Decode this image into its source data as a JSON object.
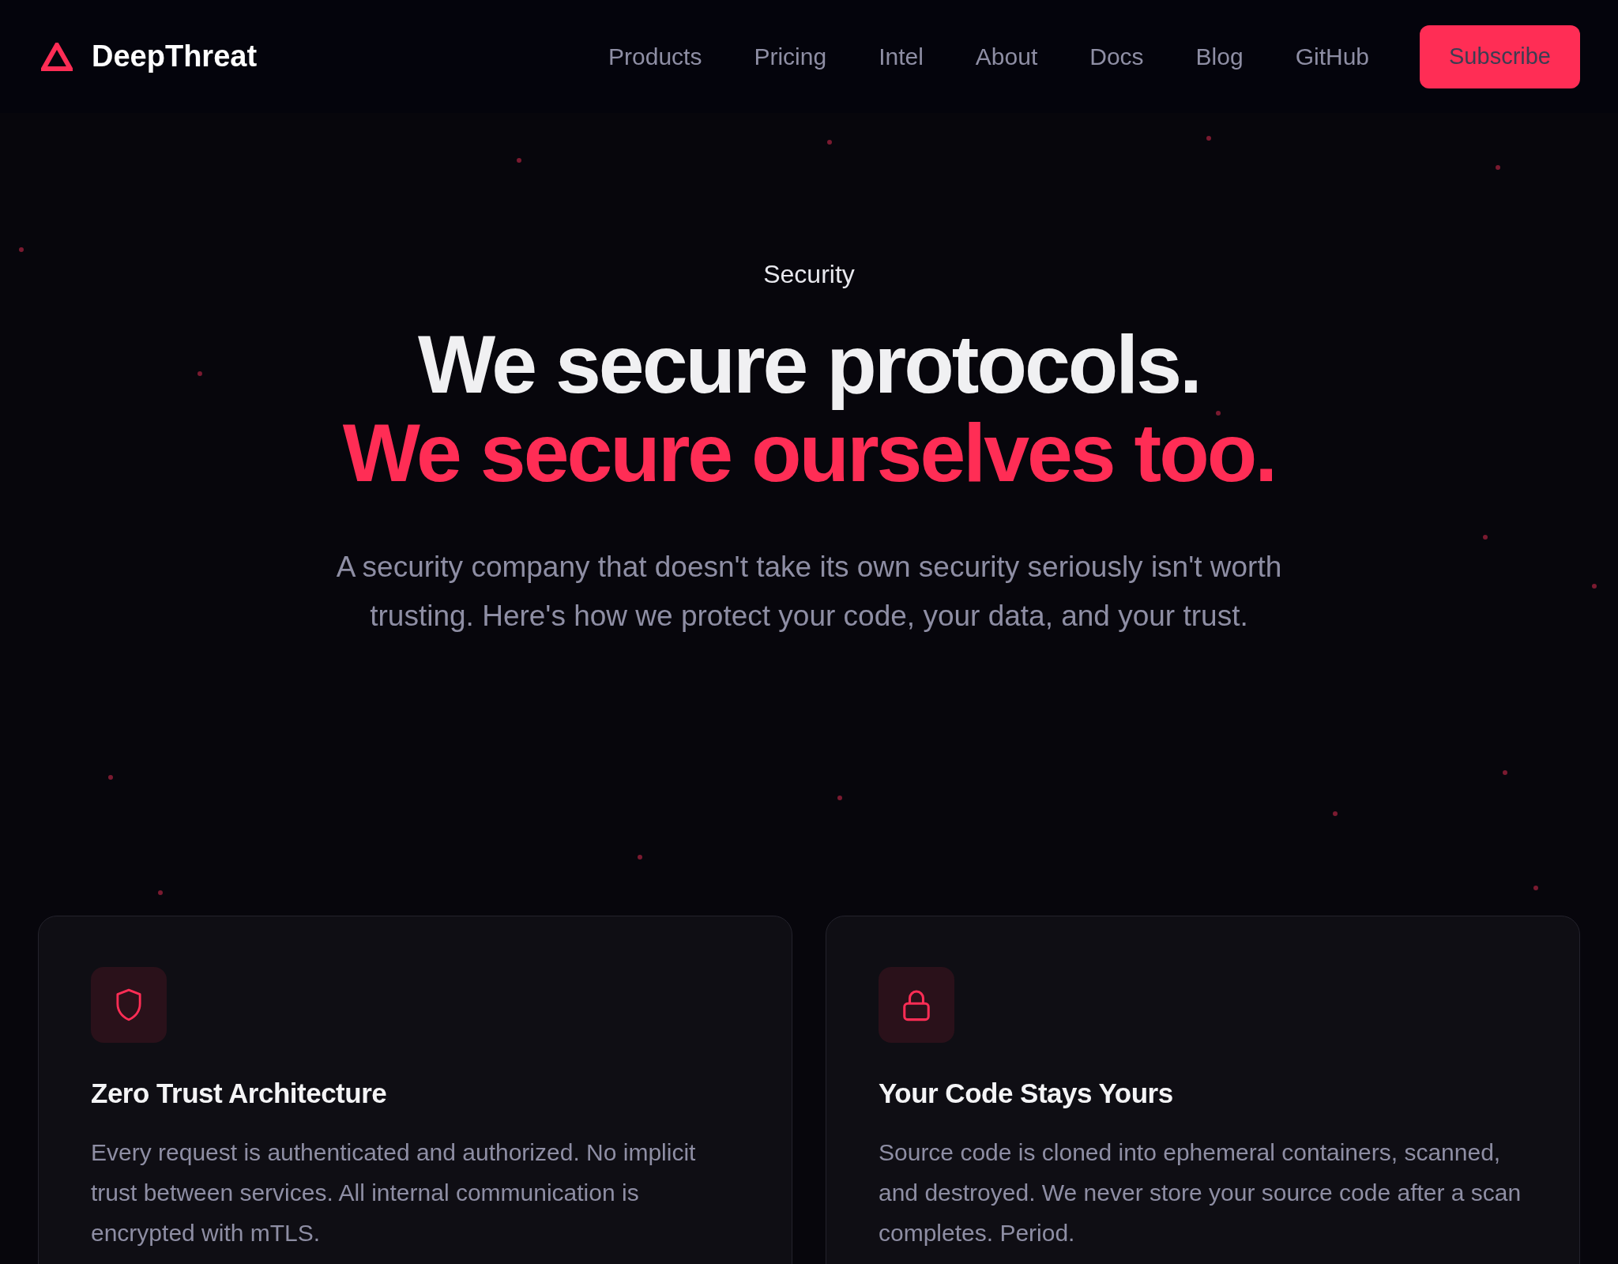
{
  "brand": {
    "name": "DeepThreat"
  },
  "nav": {
    "links": [
      "Products",
      "Pricing",
      "Intel",
      "About",
      "Docs",
      "Blog",
      "GitHub"
    ],
    "cta": "Subscribe"
  },
  "hero": {
    "eyebrow": "Security",
    "headline": "We secure protocols.",
    "headline_accent": "We secure ourselves too.",
    "intro": "A security company that doesn't take its own security seriously isn't worth trusting. Here's how we protect your code, your data, and your trust."
  },
  "cards": [
    {
      "title": "Zero Trust Architecture",
      "body": "Every request is authenticated and authorized. No implicit trust between services. All internal communication is encrypted with mTLS."
    },
    {
      "title": "Your Code Stays Yours",
      "body": "Source code is cloned into ephemeral containers, scanned, and destroyed. We never store your source code after a scan completes. Period."
    }
  ]
}
